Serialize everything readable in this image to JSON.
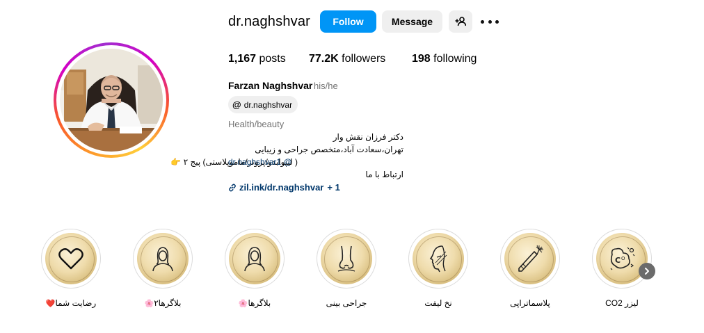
{
  "profile": {
    "username": "dr.naghshvar",
    "full_name": "Farzan Naghshvar",
    "pronouns": "his/he",
    "threads_handle": "dr.naghshvar",
    "category": "Health/beauty"
  },
  "actions": {
    "follow_label": "Follow",
    "message_label": "Message"
  },
  "stats": {
    "posts_count": "1,167",
    "posts_label": "posts",
    "followers_count": "77.2K",
    "followers_label": "followers",
    "following_count": "198",
    "following_label": "following"
  },
  "bio": {
    "line1": "دکتر فرزان نقش وار",
    "line2": "تهران،سعادت آباد،متخصص جراحی و زیبایی",
    "line3": "( لیپوابدو/پروتز/ماموپلاستی) پیج ۲ 👉",
    "mention": "dr.naghshvar1 @",
    "line4": "ارتباط با ما"
  },
  "link": {
    "text": "zil.ink/dr.naghshvar",
    "extra": "+ 1"
  },
  "highlights": [
    {
      "label": "رضایت شما",
      "emoji": "❤️",
      "icon": "heart-icon"
    },
    {
      "label": "بلاگرها۲",
      "emoji": "🌸",
      "icon": "woman-icon"
    },
    {
      "label": "بلاگرها",
      "emoji": "🌸",
      "icon": "woman-icon"
    },
    {
      "label": "جراحی بینی",
      "emoji": "",
      "icon": "nose-icon"
    },
    {
      "label": "نخ لیفت",
      "emoji": "",
      "icon": "face-profile-icon"
    },
    {
      "label": "پلاسماتراپی",
      "emoji": "",
      "icon": "plasma-pen-icon"
    },
    {
      "label": "لیزر CO2",
      "emoji": "",
      "icon": "laser-co2-icon"
    }
  ],
  "colors": {
    "follow_button": "#0095f6",
    "secondary_button": "#efefef",
    "link": "#00376b",
    "muted": "#737373",
    "highlight_gold": "#e6cf98"
  }
}
